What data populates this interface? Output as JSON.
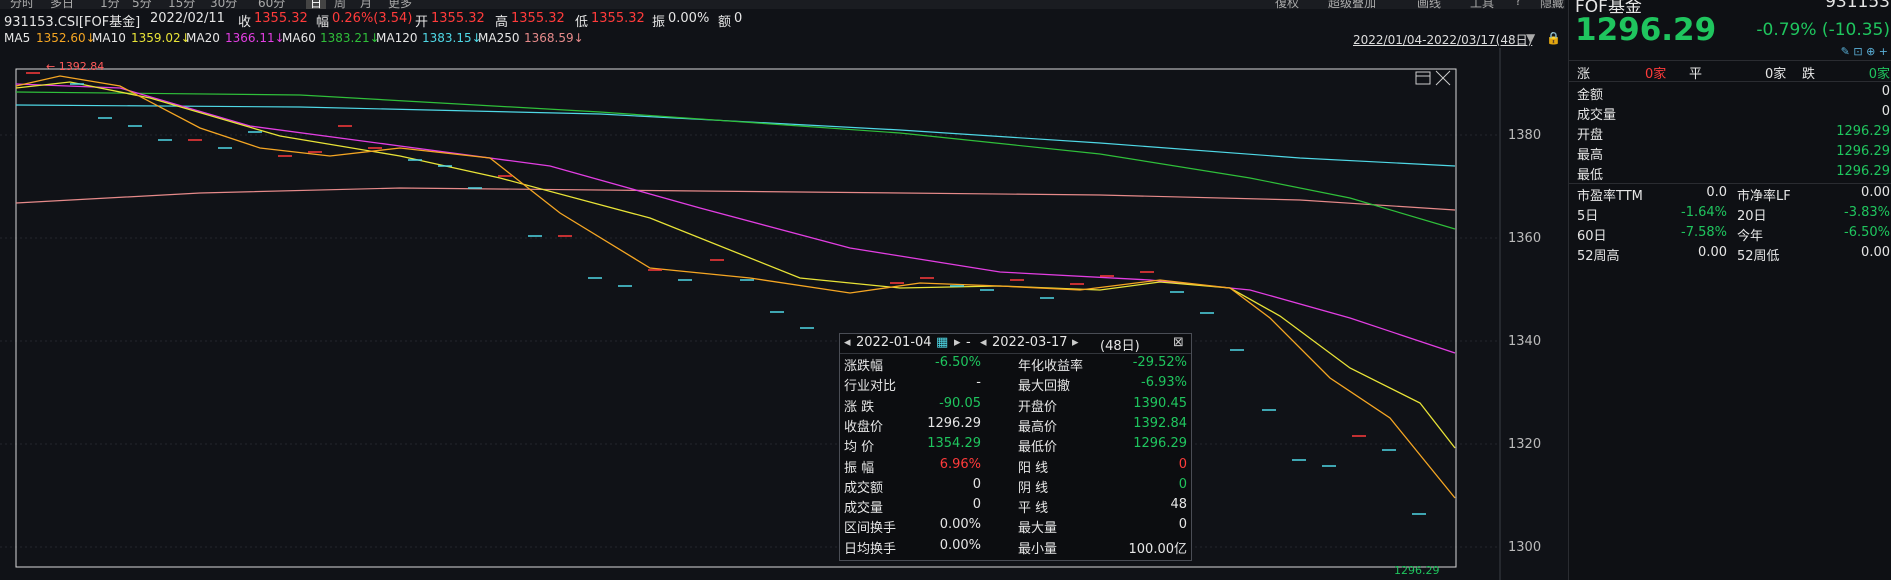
{
  "topbar": {
    "items": [
      "分时",
      "多日",
      "1分",
      "5分",
      "15分",
      "30分",
      "60分",
      "日",
      "周",
      "月",
      "更多"
    ],
    "right_items": [
      "復权",
      "超级叠加",
      "画线",
      "工具",
      "?",
      "隐藏"
    ]
  },
  "info": {
    "code": "931153.CSI[FOF基金]",
    "date": "2022/02/11",
    "close_label": "收",
    "close": "1355.32",
    "chg_label": "幅",
    "chg": "0.26%(3.54)",
    "open_label": "开",
    "open": "1355.32",
    "high_label": "高",
    "high": "1355.32",
    "low_label": "低",
    "low": "1355.32",
    "amp_label": "振",
    "amp": "0.00%",
    "amount_label": "额",
    "amount": "0"
  },
  "ma": [
    {
      "label": "MA5",
      "value": "1352.60↓",
      "color": "#f5a623"
    },
    {
      "label": "MA10",
      "value": "1359.02↓",
      "color": "#e8e337"
    },
    {
      "label": "MA20",
      "value": "1366.11↓",
      "color": "#e23ee2"
    },
    {
      "label": "MA60",
      "value": "1383.21↓",
      "color": "#2fbf3a"
    },
    {
      "label": "MA120",
      "value": "1383.15↓",
      "color": "#4fd8e6"
    },
    {
      "label": "MA250",
      "value": "1368.59↓",
      "color": "#e68a8a"
    }
  ],
  "date_range_text": "2022/01/04-2022/03/17(48日)",
  "chart": {
    "high_marker": "1392.84",
    "last_price_tag": "1296.29",
    "y_labels": [
      "1380",
      "1360",
      "1340",
      "1320",
      "1300"
    ]
  },
  "chart_data": {
    "type": "line",
    "y_ticks": [
      1380,
      1360,
      1340,
      1320,
      1300
    ],
    "ylim": [
      1296,
      1398
    ]
  },
  "popup": {
    "start_date": "2022-01-04",
    "end_date": "2022-03-17",
    "days": "(48日)",
    "dash": "-",
    "rows": [
      {
        "l1": "涨跌幅",
        "v1": "-6.50%",
        "c1": "green",
        "l2": "年化收益率",
        "v2": "-29.52%",
        "c2": "green"
      },
      {
        "l1": "行业对比",
        "v1": "-",
        "c1": "white",
        "l2": "最大回撤",
        "v2": "-6.93%",
        "c2": "green"
      },
      {
        "l1": "涨  跌",
        "v1": "-90.05",
        "c1": "green",
        "l2": "开盘价",
        "v2": "1390.45",
        "c2": "green"
      },
      {
        "l1": "收盘价",
        "v1": "1296.29",
        "c1": "white",
        "l2": "最高价",
        "v2": "1392.84",
        "c2": "green"
      },
      {
        "l1": "均  价",
        "v1": "1354.29",
        "c1": "green",
        "l2": "最低价",
        "v2": "1296.29",
        "c2": "green"
      },
      {
        "l1": "振  幅",
        "v1": "6.96%",
        "c1": "red",
        "l2": "阳  线",
        "v2": "0",
        "c2": "red"
      },
      {
        "l1": "成交额",
        "v1": "0",
        "c1": "white",
        "l2": "阴  线",
        "v2": "0",
        "c2": "green"
      },
      {
        "l1": "成交量",
        "v1": "0",
        "c1": "white",
        "l2": "平  线",
        "v2": "48",
        "c2": "white"
      },
      {
        "l1": "区间换手",
        "v1": "0.00%",
        "c1": "white",
        "l2": "最大量",
        "v2": "0",
        "c2": "white"
      },
      {
        "l1": "日均换手",
        "v1": "0.00%",
        "c1": "white",
        "l2": "最小量",
        "v2": "100.00亿",
        "c2": "white"
      }
    ]
  },
  "quote": {
    "name": "FOF基金",
    "code": "931153",
    "price": "1296.29",
    "change": "-0.79% (-10.35)",
    "rise_label": "涨",
    "rise_count": "0家",
    "flat_label": "平",
    "flat_count": "0家",
    "fall_label": "跌",
    "fall_count": "0家",
    "fields": [
      {
        "label": "金额",
        "value": "0",
        "color": "white"
      },
      {
        "label": "成交量",
        "value": "0",
        "color": "white"
      },
      {
        "label": "开盘",
        "value": "1296.29",
        "color": "green"
      },
      {
        "label": "最高",
        "value": "1296.29",
        "color": "green"
      },
      {
        "label": "最低",
        "value": "1296.29",
        "color": "green"
      }
    ],
    "stats": [
      {
        "l1": "市盈率TTM",
        "v1": "0.0",
        "c1": "white",
        "l2": "市净率LF",
        "v2": "0.00",
        "c2": "white"
      },
      {
        "l1": "5日",
        "v1": "-1.64%",
        "c1": "green",
        "l2": "20日",
        "v2": "-3.83%",
        "c2": "green"
      },
      {
        "l1": "60日",
        "v1": "-7.58%",
        "c1": "green",
        "l2": "今年",
        "v2": "-6.50%",
        "c2": "green"
      },
      {
        "l1": "52周高",
        "v1": "0.00",
        "c1": "white",
        "l2": "52周低",
        "v2": "0.00",
        "c2": "white"
      }
    ]
  },
  "colors": {
    "red": "#ff3b3b",
    "green": "#1fc55e",
    "cyan": "#4fd8e6",
    "bg": "#101217"
  }
}
